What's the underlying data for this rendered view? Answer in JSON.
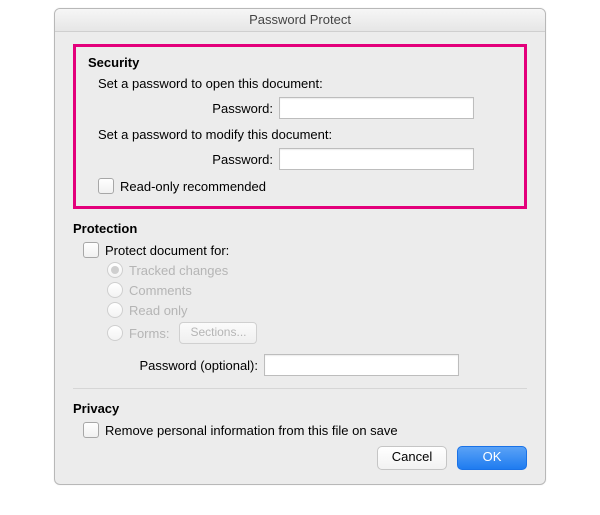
{
  "title": "Password Protect",
  "security": {
    "heading": "Security",
    "open_prompt": "Set a password to open this document:",
    "open_label": "Password:",
    "open_value": "",
    "modify_prompt": "Set a password to modify this document:",
    "modify_label": "Password:",
    "modify_value": "",
    "readonly_label": "Read-only recommended"
  },
  "protection": {
    "heading": "Protection",
    "protect_for_label": "Protect document for:",
    "radios": {
      "tracked": "Tracked changes",
      "comments": "Comments",
      "readonly": "Read only",
      "forms": "Forms:"
    },
    "sections_btn": "Sections...",
    "password_optional_label": "Password (optional):",
    "password_optional_value": ""
  },
  "privacy": {
    "heading": "Privacy",
    "remove_label": "Remove personal information from this file on save"
  },
  "buttons": {
    "cancel": "Cancel",
    "ok": "OK"
  }
}
